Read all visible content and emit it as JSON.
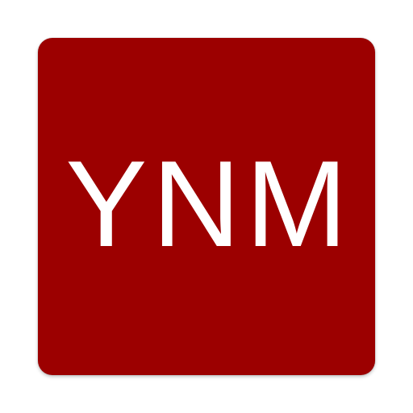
{
  "icon": {
    "text": "YNM",
    "background_color": "#9c0000",
    "text_color": "#ffffff"
  }
}
